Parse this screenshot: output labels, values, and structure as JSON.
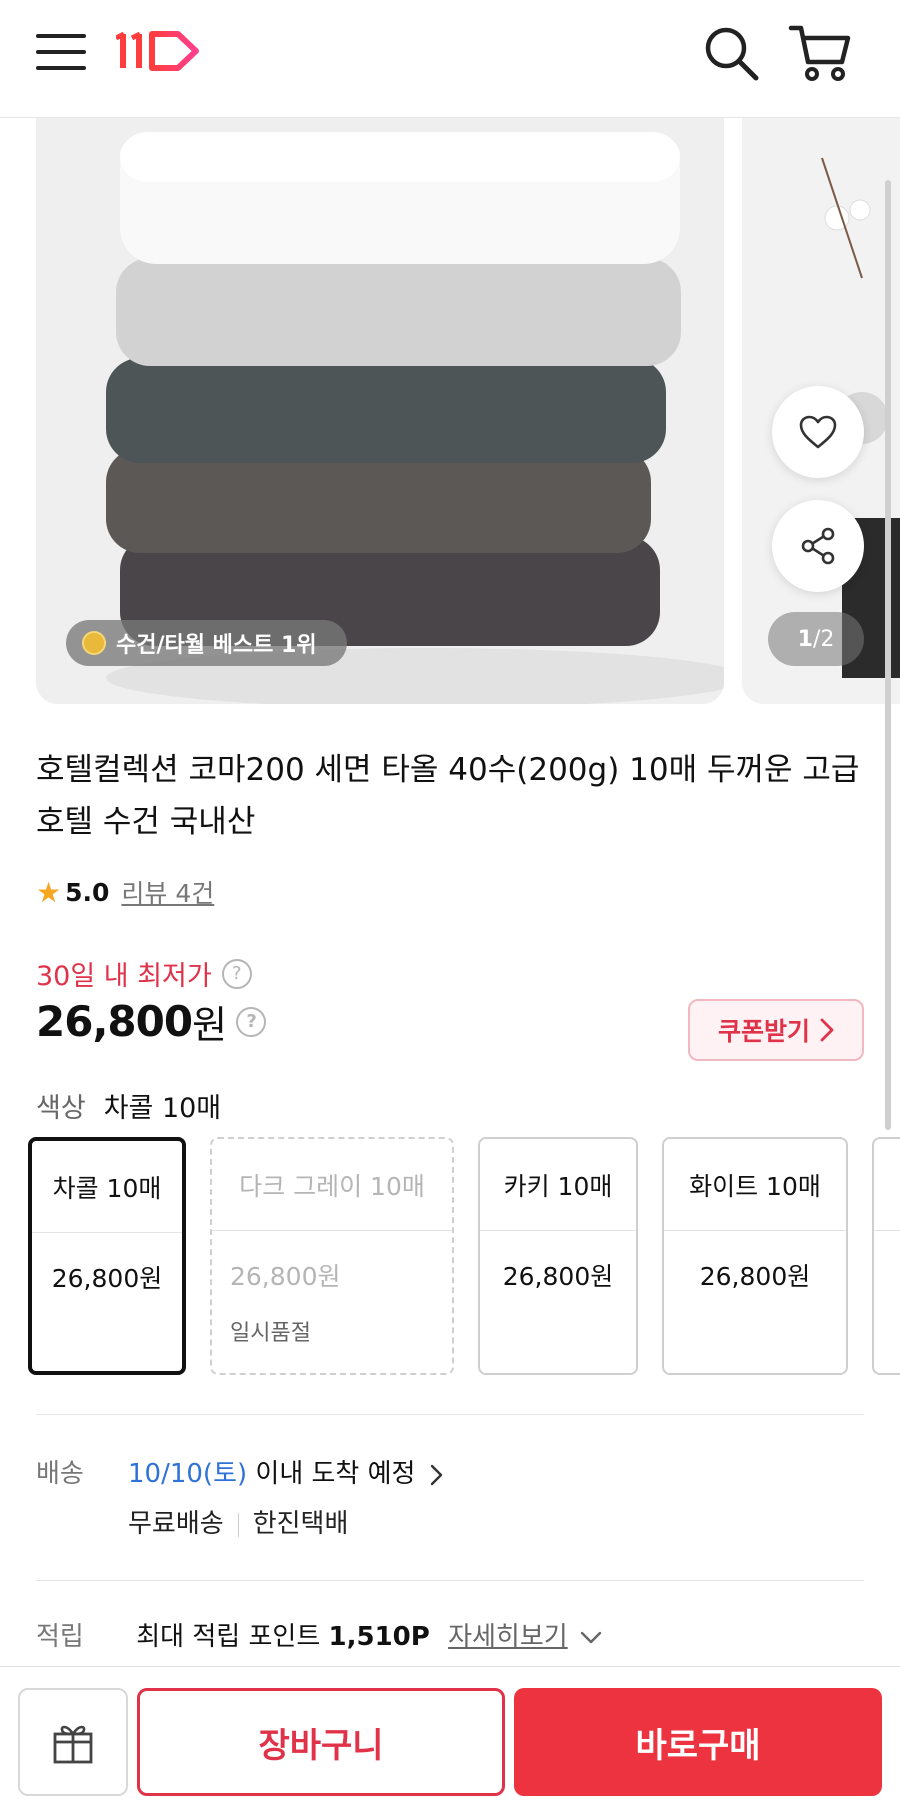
{
  "header": {
    "logo_text": "11",
    "menu_icon": "hamburger-menu-icon",
    "search_icon": "search-icon",
    "cart_icon": "cart-icon"
  },
  "gallery": {
    "badge": "수건/타월 베스트 1위",
    "counter_current": "1",
    "counter_sep": "/",
    "counter_total": "2"
  },
  "product": {
    "title": "호텔컬렉션 코마200 세면 타올 40수(200g) 10매 두꺼운 고급 호텔 수건 국내산",
    "rating": "5.0",
    "review": "리뷰 4건",
    "lowest_label": "30일 내 최저가",
    "price_number": "26,800",
    "price_unit": "원",
    "coupon": "쿠폰받기",
    "color_label": "색상",
    "color_value": "차콜 10매"
  },
  "options": [
    {
      "name": "차콜 10매",
      "price": "26,800원",
      "status": "",
      "state": "selected"
    },
    {
      "name": "다크 그레이 10매",
      "price": "26,800원",
      "status": "일시품절",
      "state": "disabled"
    },
    {
      "name": "카키 10매",
      "price": "26,800원",
      "status": "",
      "state": "normal"
    },
    {
      "name": "화이트 10매",
      "price": "26,800원",
      "status": "",
      "state": "normal"
    }
  ],
  "shipping": {
    "label": "배송",
    "date": "10/10(토)",
    "arrival": "이내 도착 예정",
    "free": "무료배송",
    "carrier": "한진택배"
  },
  "points": {
    "label": "적립",
    "text": "최대 적립 포인트",
    "amount": "1,510P",
    "more": "자세히보기"
  },
  "bottom": {
    "gift_icon": "gift-icon",
    "cart_button": "장바구니",
    "buy_button": "바로구매"
  },
  "colors": {
    "accent": "#ee3340",
    "link": "#2f72d8",
    "coupon_bg": "#fff2f4"
  }
}
